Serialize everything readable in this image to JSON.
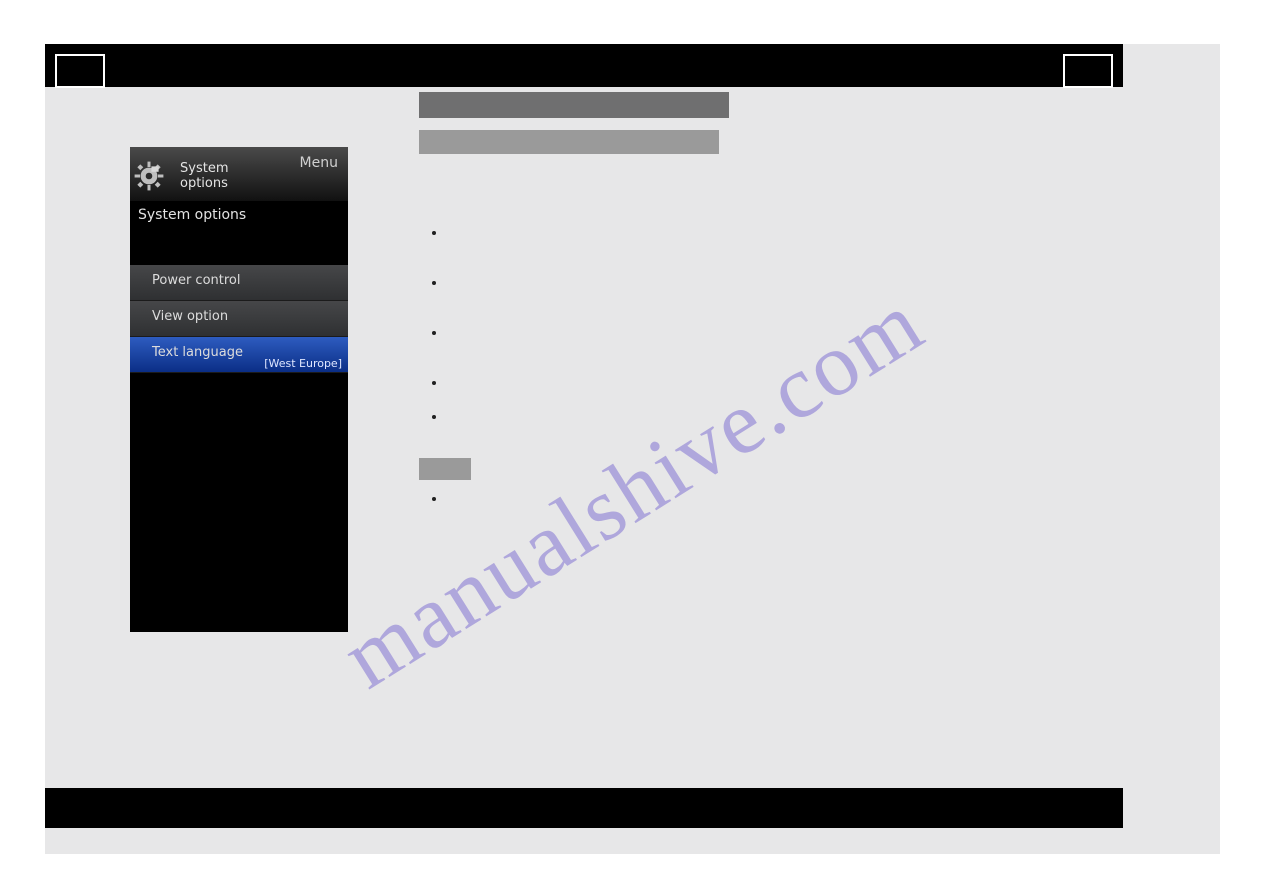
{
  "watermark": "manualshive.com",
  "tv_menu": {
    "menu_label": "Menu",
    "icon_caption_line1": "System",
    "icon_caption_line2": "options",
    "subheader": "System options",
    "items": [
      {
        "label": "Power control",
        "value": ""
      },
      {
        "label": "View option",
        "value": ""
      },
      {
        "label": "Text language",
        "value": "[West Europe]"
      }
    ],
    "selected_index": 2
  }
}
